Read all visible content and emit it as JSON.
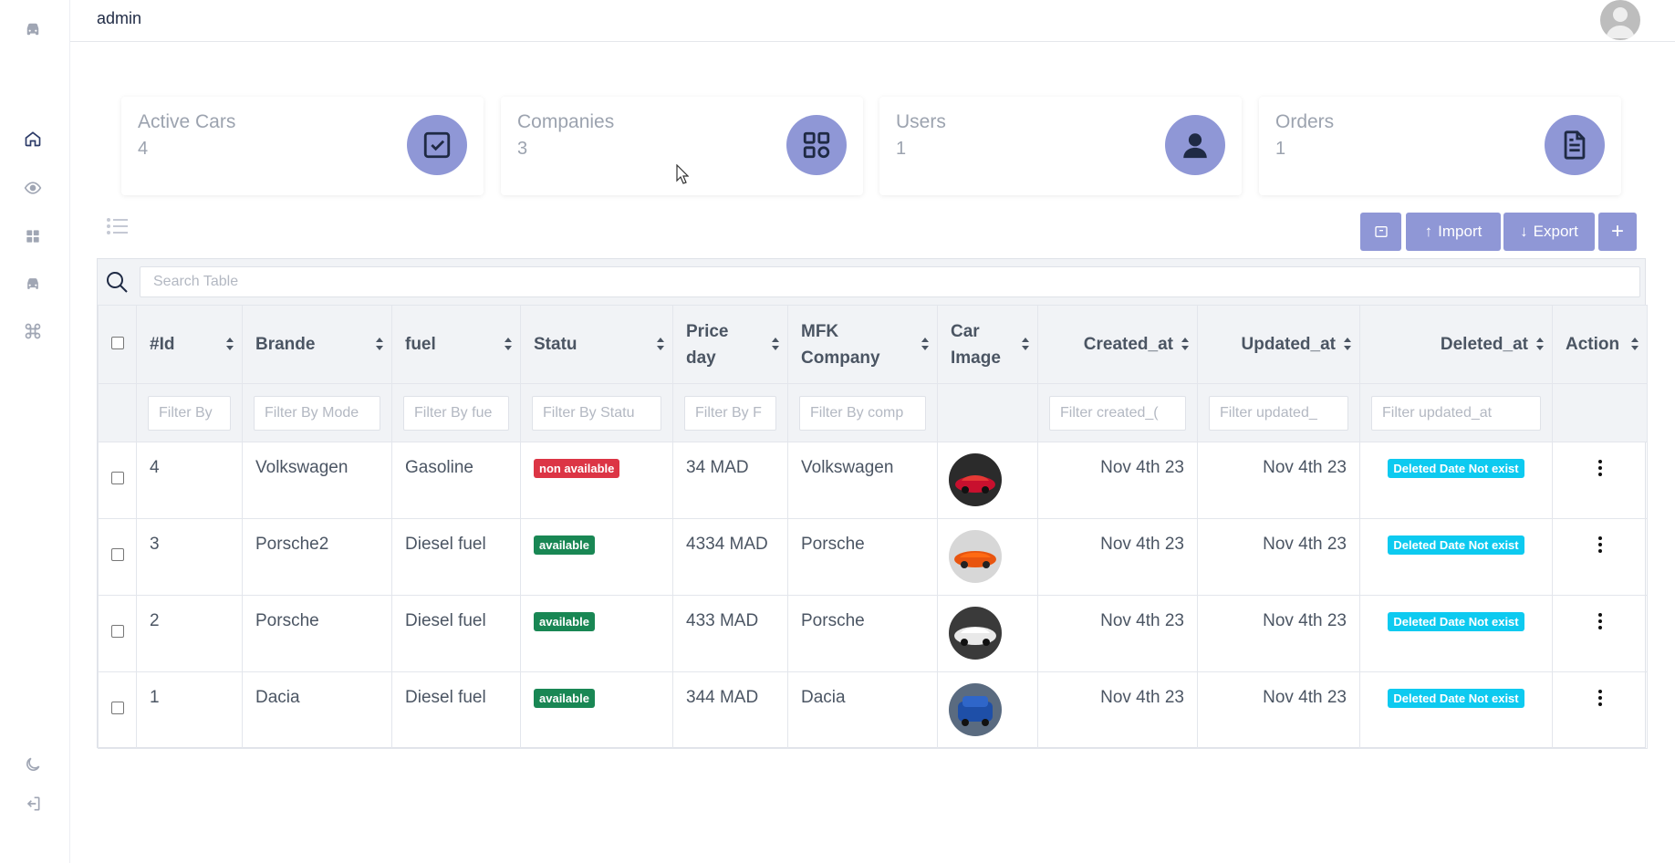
{
  "topbar": {
    "user": "admin"
  },
  "sidebar": {
    "items": [
      {
        "icon": "car-icon"
      },
      {
        "icon": "home-icon"
      },
      {
        "icon": "eye-icon"
      },
      {
        "icon": "grid-icon"
      },
      {
        "icon": "car-icon"
      },
      {
        "icon": "command-icon"
      },
      {
        "icon": "moon-icon"
      },
      {
        "icon": "logout-icon"
      }
    ]
  },
  "cards": [
    {
      "title": "Active Cars",
      "value": "4",
      "icon": "checkbox-icon"
    },
    {
      "title": "Companies",
      "value": "3",
      "icon": "apps-icon"
    },
    {
      "title": "Users",
      "value": "1",
      "icon": "user-icon"
    },
    {
      "title": "Orders",
      "value": "1",
      "icon": "document-icon"
    }
  ],
  "toolbar": {
    "import_label": "Import",
    "export_label": "Export",
    "add_label": "+"
  },
  "search": {
    "placeholder": "Search Table"
  },
  "table": {
    "columns": [
      "#Id",
      "Brande",
      "fuel",
      "Statu",
      "Price day",
      "MFK Company",
      "Car Image",
      "Created_at",
      "Updated_at",
      "Deleted_at",
      "Action"
    ],
    "filters": [
      "Filter By",
      "Filter By Mode",
      "Filter By fue",
      "Filter By Statu",
      "Filter By F",
      "Filter By comp",
      "",
      "Filter created_(",
      "Filter updated_",
      "Filter updated_at"
    ],
    "rows": [
      {
        "id": "4",
        "brand": "Volkswagen",
        "fuel": "Gasoline",
        "status": "non available",
        "price": "34 MAD",
        "company": "Volkswagen",
        "created": "Nov 4th 23",
        "updated": "Nov 4th 23",
        "deleted": "Deleted Date Not exist"
      },
      {
        "id": "3",
        "brand": "Porsche2",
        "fuel": "Diesel fuel",
        "status": "available",
        "price": "4334 MAD",
        "company": "Porsche",
        "created": "Nov 4th 23",
        "updated": "Nov 4th 23",
        "deleted": "Deleted Date Not exist"
      },
      {
        "id": "2",
        "brand": "Porsche",
        "fuel": "Diesel fuel",
        "status": "available",
        "price": "433 MAD",
        "company": "Porsche",
        "created": "Nov 4th 23",
        "updated": "Nov 4th 23",
        "deleted": "Deleted Date Not exist"
      },
      {
        "id": "1",
        "brand": "Dacia",
        "fuel": "Diesel fuel",
        "status": "available",
        "price": "344 MAD",
        "company": "Dacia",
        "created": "Nov 4th 23",
        "updated": "Nov 4th 23",
        "deleted": "Deleted Date Not exist"
      }
    ]
  },
  "colors": {
    "accent": "#8f97d6",
    "danger": "#dc3545",
    "success": "#198754",
    "info": "#0dcaf0"
  }
}
